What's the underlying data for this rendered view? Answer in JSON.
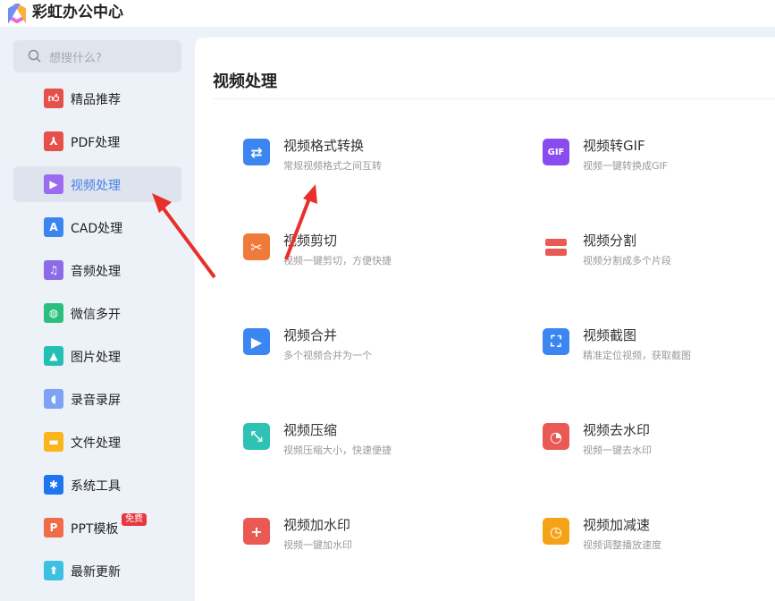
{
  "app": {
    "title": "彩虹办公中心"
  },
  "search": {
    "placeholder": "想搜什么?"
  },
  "sidebar": {
    "items": [
      {
        "label": "精品推荐",
        "icon": "thumbs-up-icon",
        "color": "#e5504a"
      },
      {
        "label": "PDF处理",
        "icon": "pdf-icon",
        "color": "#e5504a"
      },
      {
        "label": "视频处理",
        "icon": "play-icon",
        "color": "#9b6cf0",
        "active": true
      },
      {
        "label": "CAD处理",
        "icon": "cad-icon",
        "color": "#3d85ee"
      },
      {
        "label": "音频处理",
        "icon": "music-icon",
        "color": "#8c6ce6"
      },
      {
        "label": "微信多开",
        "icon": "wechat-icon",
        "color": "#2bbf7d"
      },
      {
        "label": "图片处理",
        "icon": "image-icon",
        "color": "#23bfb5"
      },
      {
        "label": "录音录屏",
        "icon": "microphone-icon",
        "color": "#7fa2f5"
      },
      {
        "label": "文件处理",
        "icon": "folder-icon",
        "color": "#f9b51b"
      },
      {
        "label": "系统工具",
        "icon": "gear-icon",
        "color": "#1f74f0"
      },
      {
        "label": "PPT模板",
        "icon": "ppt-icon",
        "color": "#ee6d48",
        "badge": "免费"
      },
      {
        "label": "最新更新",
        "icon": "upload-icon",
        "color": "#3cc2e0"
      }
    ]
  },
  "main": {
    "title": "视频处理",
    "tools": [
      {
        "name": "视频格式转换",
        "desc": "常规视频格式之间互转",
        "icon": "swap-icon",
        "color": "#3b86f0",
        "glyph": "⇄"
      },
      {
        "name": "视频转GIF",
        "desc": "视频一键转换成GIF",
        "icon": "gif-icon",
        "color": "#8a4cf0",
        "glyph": "GIF"
      },
      {
        "name": "视频剪切",
        "desc": "视频一键剪切，方便快捷",
        "icon": "scissors-icon",
        "color": "#f07a3a",
        "glyph": "✂"
      },
      {
        "name": "视频分割",
        "desc": "视频分割成多个片段",
        "icon": "split-icon",
        "color": "#ea5a55",
        "glyph": ""
      },
      {
        "name": "视频合并",
        "desc": "多个视频合并为一个",
        "icon": "merge-icon",
        "color": "#3b86f0",
        "glyph": "▶"
      },
      {
        "name": "视频截图",
        "desc": "精准定位视频，获取截图",
        "icon": "crop-icon",
        "color": "#3b86f0",
        "glyph": "⛶"
      },
      {
        "name": "视频压缩",
        "desc": "视频压缩大小，快速便捷",
        "icon": "compress-icon",
        "color": "#2ec2b4",
        "glyph": "⤡"
      },
      {
        "name": "视频去水印",
        "desc": "视频一键去水印",
        "icon": "watermark-remove-icon",
        "color": "#ea5a55",
        "glyph": "◔"
      },
      {
        "name": "视频加水印",
        "desc": "视频一键加水印",
        "icon": "watermark-add-icon",
        "color": "#ea5a55",
        "glyph": "+"
      },
      {
        "name": "视频加减速",
        "desc": "视频调整播放速度",
        "icon": "speed-icon",
        "color": "#f5a316",
        "glyph": "◷"
      }
    ]
  }
}
